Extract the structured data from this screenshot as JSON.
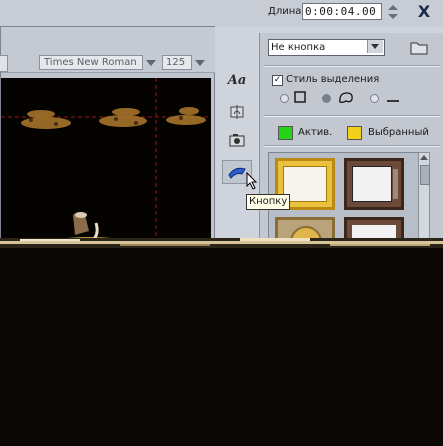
{
  "header": {
    "length_label": "Длина:",
    "timecode": "0:00:04.00",
    "close_label": "X"
  },
  "text_toolbar": {
    "font_name": "Times New Roman",
    "font_size": "125"
  },
  "sidebar_tools": {
    "text_tool_icon": "text-aa-icon",
    "tooltip": "Кнопку"
  },
  "menu_panel": {
    "menu_selection": "Не кнопка",
    "highlight_style_label": "Стиль выделения",
    "highlight_style_checked": true,
    "active_label": "Актив.",
    "active_color": "#26d318",
    "selected_label": "Выбранный",
    "selected_color": "#f2d11a"
  }
}
